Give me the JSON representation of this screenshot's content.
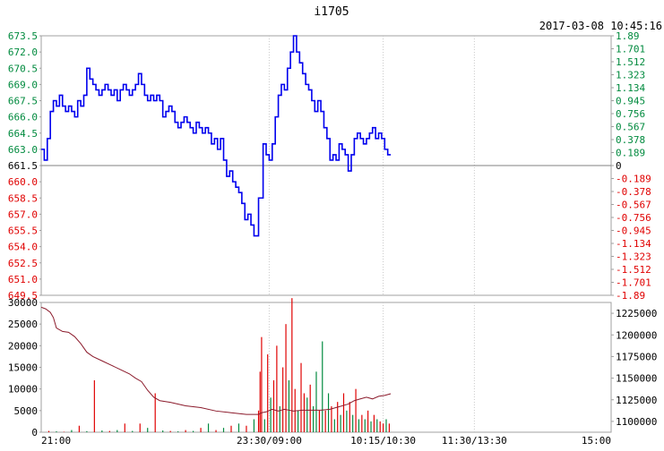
{
  "header": {
    "title": "i1705",
    "timestamp": "2017-03-08 10:45:16"
  },
  "colors": {
    "up": "#e00000",
    "down": "#008a3e",
    "price_line": "#0000ee",
    "volume_up": "#e00000",
    "volume_down": "#008a3e",
    "open_interest_line": "#8b1a2b",
    "grid": "#c8c8c8",
    "baseline": "#808080",
    "axis_text": "#000000"
  },
  "chart_data": [
    {
      "type": "line",
      "name": "price",
      "baseline_price": 661.5,
      "ylim": [
        649.5,
        673.5
      ],
      "y_ticks_left": [
        "673.5",
        "672.0",
        "670.5",
        "669.0",
        "667.5",
        "666.0",
        "664.5",
        "663.0",
        "661.5",
        "660.0",
        "658.5",
        "657.0",
        "655.5",
        "654.0",
        "652.5",
        "651.0",
        "649.5"
      ],
      "y_ticks_right": [
        "1.89",
        "1.701",
        "1.512",
        "1.323",
        "1.134",
        "0.945",
        "0.756",
        "0.567",
        "0.378",
        "0.189",
        "0",
        "-0.189",
        "-0.378",
        "-0.567",
        "-0.756",
        "-0.945",
        "-1.134",
        "-1.323",
        "-1.512",
        "-1.701",
        "-1.89"
      ],
      "right_ylim": [
        -1.89,
        1.89
      ],
      "right_axis_unit": "%",
      "x_ticks": [
        "21:00",
        "23:30/09:00",
        "10:15/10:30",
        "11:30/13:30",
        "15:00"
      ],
      "x_tick_positions": [
        0,
        150,
        225,
        285,
        375
      ],
      "x_range": [
        0,
        375
      ],
      "grid": true,
      "points": [
        [
          0,
          663.0
        ],
        [
          2,
          662.0
        ],
        [
          4,
          664.0
        ],
        [
          6,
          666.5
        ],
        [
          8,
          667.5
        ],
        [
          10,
          667.0
        ],
        [
          12,
          668.0
        ],
        [
          14,
          667.0
        ],
        [
          16,
          666.5
        ],
        [
          18,
          667.0
        ],
        [
          20,
          666.5
        ],
        [
          22,
          666.0
        ],
        [
          24,
          667.5
        ],
        [
          26,
          667.0
        ],
        [
          28,
          668.0
        ],
        [
          30,
          670.5
        ],
        [
          32,
          669.5
        ],
        [
          34,
          669.0
        ],
        [
          36,
          668.5
        ],
        [
          38,
          668.0
        ],
        [
          40,
          668.5
        ],
        [
          42,
          669.0
        ],
        [
          44,
          668.5
        ],
        [
          46,
          668.0
        ],
        [
          48,
          668.5
        ],
        [
          50,
          667.5
        ],
        [
          52,
          668.5
        ],
        [
          54,
          669.0
        ],
        [
          56,
          668.5
        ],
        [
          58,
          668.0
        ],
        [
          60,
          668.5
        ],
        [
          62,
          669.0
        ],
        [
          64,
          670.0
        ],
        [
          66,
          669.0
        ],
        [
          68,
          668.0
        ],
        [
          70,
          667.5
        ],
        [
          72,
          668.0
        ],
        [
          74,
          667.5
        ],
        [
          76,
          668.0
        ],
        [
          78,
          667.5
        ],
        [
          80,
          666.0
        ],
        [
          82,
          666.5
        ],
        [
          84,
          667.0
        ],
        [
          86,
          666.5
        ],
        [
          88,
          665.5
        ],
        [
          90,
          665.0
        ],
        [
          92,
          665.5
        ],
        [
          94,
          666.0
        ],
        [
          96,
          665.5
        ],
        [
          98,
          665.0
        ],
        [
          100,
          664.5
        ],
        [
          102,
          665.5
        ],
        [
          104,
          665.0
        ],
        [
          106,
          664.5
        ],
        [
          108,
          665.0
        ],
        [
          110,
          664.5
        ],
        [
          112,
          663.5
        ],
        [
          114,
          664.0
        ],
        [
          116,
          663.0
        ],
        [
          118,
          664.0
        ],
        [
          120,
          662.0
        ],
        [
          122,
          660.5
        ],
        [
          124,
          661.0
        ],
        [
          126,
          660.0
        ],
        [
          128,
          659.5
        ],
        [
          130,
          659.0
        ],
        [
          132,
          658.0
        ],
        [
          134,
          656.5
        ],
        [
          136,
          657.0
        ],
        [
          138,
          656.0
        ],
        [
          140,
          655.0
        ],
        [
          143,
          658.5
        ],
        [
          146,
          663.5
        ],
        [
          148,
          662.5
        ],
        [
          150,
          662.0
        ],
        [
          152,
          663.5
        ],
        [
          154,
          666.0
        ],
        [
          156,
          668.0
        ],
        [
          158,
          669.0
        ],
        [
          160,
          668.5
        ],
        [
          162,
          670.5
        ],
        [
          164,
          672.0
        ],
        [
          166,
          673.5
        ],
        [
          168,
          672.0
        ],
        [
          170,
          671.0
        ],
        [
          172,
          670.0
        ],
        [
          174,
          669.0
        ],
        [
          176,
          668.5
        ],
        [
          178,
          667.5
        ],
        [
          180,
          666.5
        ],
        [
          182,
          667.5
        ],
        [
          184,
          666.5
        ],
        [
          186,
          665.0
        ],
        [
          188,
          664.0
        ],
        [
          190,
          662.0
        ],
        [
          192,
          662.5
        ],
        [
          194,
          662.0
        ],
        [
          196,
          663.5
        ],
        [
          198,
          663.0
        ],
        [
          200,
          662.5
        ],
        [
          202,
          661.0
        ],
        [
          204,
          662.5
        ],
        [
          206,
          664.0
        ],
        [
          208,
          664.5
        ],
        [
          210,
          664.0
        ],
        [
          212,
          663.5
        ],
        [
          214,
          664.0
        ],
        [
          216,
          664.5
        ],
        [
          218,
          665.0
        ],
        [
          220,
          664.0
        ],
        [
          222,
          664.5
        ],
        [
          224,
          664.0
        ],
        [
          226,
          663.0
        ],
        [
          228,
          662.5
        ],
        [
          230,
          662.5
        ]
      ]
    },
    {
      "type": "bar",
      "name": "volume",
      "ylim": [
        0,
        30000
      ],
      "y_ticks": [
        "30000",
        "25000",
        "20000",
        "15000",
        "10000",
        "5000",
        "0"
      ],
      "bars": [
        [
          5,
          300,
          1
        ],
        [
          10,
          200,
          0
        ],
        [
          15,
          100,
          1
        ],
        [
          20,
          500,
          0
        ],
        [
          25,
          1500,
          1
        ],
        [
          30,
          250,
          0
        ],
        [
          35,
          12000,
          1
        ],
        [
          40,
          400,
          0
        ],
        [
          45,
          300,
          1
        ],
        [
          50,
          500,
          0
        ],
        [
          55,
          2000,
          1
        ],
        [
          60,
          300,
          0
        ],
        [
          65,
          2000,
          1
        ],
        [
          70,
          1000,
          0
        ],
        [
          75,
          9000,
          1
        ],
        [
          80,
          400,
          0
        ],
        [
          85,
          300,
          1
        ],
        [
          90,
          200,
          0
        ],
        [
          95,
          500,
          1
        ],
        [
          100,
          300,
          0
        ],
        [
          105,
          1000,
          1
        ],
        [
          110,
          2000,
          0
        ],
        [
          115,
          500,
          1
        ],
        [
          120,
          1000,
          0
        ],
        [
          125,
          1500,
          1
        ],
        [
          130,
          2000,
          0
        ],
        [
          135,
          1500,
          1
        ],
        [
          140,
          3000,
          0
        ],
        [
          143,
          5000,
          1
        ],
        [
          144,
          14000,
          1
        ],
        [
          145,
          22000,
          1
        ],
        [
          147,
          3000,
          0
        ],
        [
          149,
          18000,
          1
        ],
        [
          151,
          8000,
          0
        ],
        [
          153,
          12000,
          1
        ],
        [
          155,
          20000,
          1
        ],
        [
          157,
          6000,
          0
        ],
        [
          159,
          15000,
          1
        ],
        [
          161,
          25000,
          1
        ],
        [
          163,
          12000,
          0
        ],
        [
          165,
          31000,
          1
        ],
        [
          167,
          10000,
          1
        ],
        [
          169,
          5000,
          0
        ],
        [
          171,
          16000,
          1
        ],
        [
          173,
          9000,
          1
        ],
        [
          175,
          8000,
          0
        ],
        [
          177,
          11000,
          1
        ],
        [
          179,
          6000,
          0
        ],
        [
          181,
          14000,
          0
        ],
        [
          183,
          5000,
          1
        ],
        [
          185,
          21000,
          0
        ],
        [
          187,
          5000,
          1
        ],
        [
          189,
          9000,
          0
        ],
        [
          191,
          6000,
          1
        ],
        [
          193,
          3000,
          0
        ],
        [
          195,
          7000,
          1
        ],
        [
          197,
          4000,
          0
        ],
        [
          199,
          9000,
          1
        ],
        [
          201,
          5000,
          0
        ],
        [
          203,
          7000,
          1
        ],
        [
          205,
          4000,
          0
        ],
        [
          207,
          10000,
          1
        ],
        [
          209,
          3000,
          0
        ],
        [
          211,
          4000,
          1
        ],
        [
          213,
          3000,
          0
        ],
        [
          215,
          5000,
          1
        ],
        [
          217,
          2500,
          0
        ],
        [
          219,
          4000,
          1
        ],
        [
          221,
          3000,
          0
        ],
        [
          223,
          2500,
          1
        ],
        [
          225,
          2000,
          1
        ],
        [
          227,
          3000,
          0
        ],
        [
          229,
          2000,
          1
        ]
      ]
    },
    {
      "type": "line",
      "name": "open_interest",
      "ylim": [
        1087500,
        1237500
      ],
      "y_ticks": [
        "1225000",
        "1200000",
        "1175000",
        "1150000",
        "1125000",
        "1100000"
      ],
      "points": [
        [
          0,
          1232000
        ],
        [
          3,
          1230000
        ],
        [
          6,
          1226000
        ],
        [
          8,
          1220000
        ],
        [
          10,
          1208000
        ],
        [
          14,
          1204000
        ],
        [
          18,
          1203000
        ],
        [
          22,
          1198000
        ],
        [
          26,
          1190000
        ],
        [
          30,
          1180000
        ],
        [
          34,
          1175000
        ],
        [
          40,
          1170000
        ],
        [
          46,
          1165000
        ],
        [
          52,
          1160000
        ],
        [
          58,
          1155000
        ],
        [
          62,
          1150000
        ],
        [
          66,
          1146000
        ],
        [
          70,
          1136000
        ],
        [
          74,
          1128000
        ],
        [
          78,
          1124000
        ],
        [
          85,
          1122000
        ],
        [
          95,
          1118000
        ],
        [
          105,
          1116000
        ],
        [
          115,
          1112000
        ],
        [
          125,
          1110000
        ],
        [
          135,
          1108000
        ],
        [
          140,
          1108000
        ],
        [
          143,
          1108000
        ],
        [
          145,
          1110000
        ],
        [
          148,
          1111000
        ],
        [
          152,
          1114000
        ],
        [
          156,
          1112000
        ],
        [
          160,
          1114000
        ],
        [
          166,
          1112000
        ],
        [
          172,
          1113000
        ],
        [
          178,
          1113000
        ],
        [
          184,
          1113000
        ],
        [
          190,
          1114000
        ],
        [
          196,
          1117000
        ],
        [
          202,
          1120000
        ],
        [
          206,
          1124000
        ],
        [
          210,
          1126000
        ],
        [
          214,
          1128000
        ],
        [
          218,
          1126000
        ],
        [
          222,
          1129000
        ],
        [
          226,
          1130000
        ],
        [
          230,
          1132000
        ]
      ]
    }
  ]
}
